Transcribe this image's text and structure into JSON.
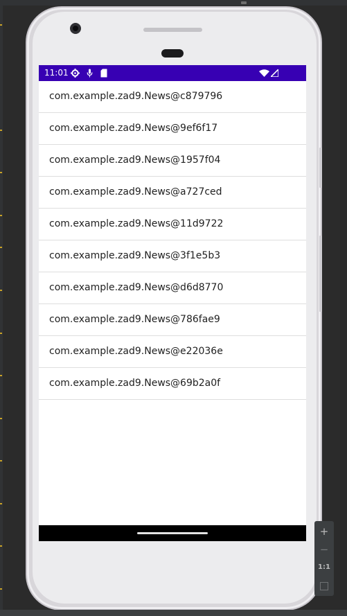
{
  "status_bar": {
    "time": "11:01",
    "background": "#3700b3",
    "icons_left": [
      "gear-icon",
      "microphone-icon",
      "sd-card-icon"
    ],
    "icons_right": [
      "wifi-icon",
      "signal-icon"
    ]
  },
  "news_list": {
    "items": [
      {
        "label": "com.example.zad9.News@c879796"
      },
      {
        "label": "com.example.zad9.News@9ef6f17"
      },
      {
        "label": "com.example.zad9.News@1957f04"
      },
      {
        "label": "com.example.zad9.News@a727ced"
      },
      {
        "label": "com.example.zad9.News@11d9722"
      },
      {
        "label": "com.example.zad9.News@3f1e5b3"
      },
      {
        "label": "com.example.zad9.News@d6d8770"
      },
      {
        "label": "com.example.zad9.News@786fae9"
      },
      {
        "label": "com.example.zad9.News@e22036e"
      },
      {
        "label": "com.example.zad9.News@69b2a0f"
      }
    ]
  },
  "zoom_controls": {
    "zoom_in": "+",
    "zoom_out": "−",
    "reset": "1:1"
  }
}
